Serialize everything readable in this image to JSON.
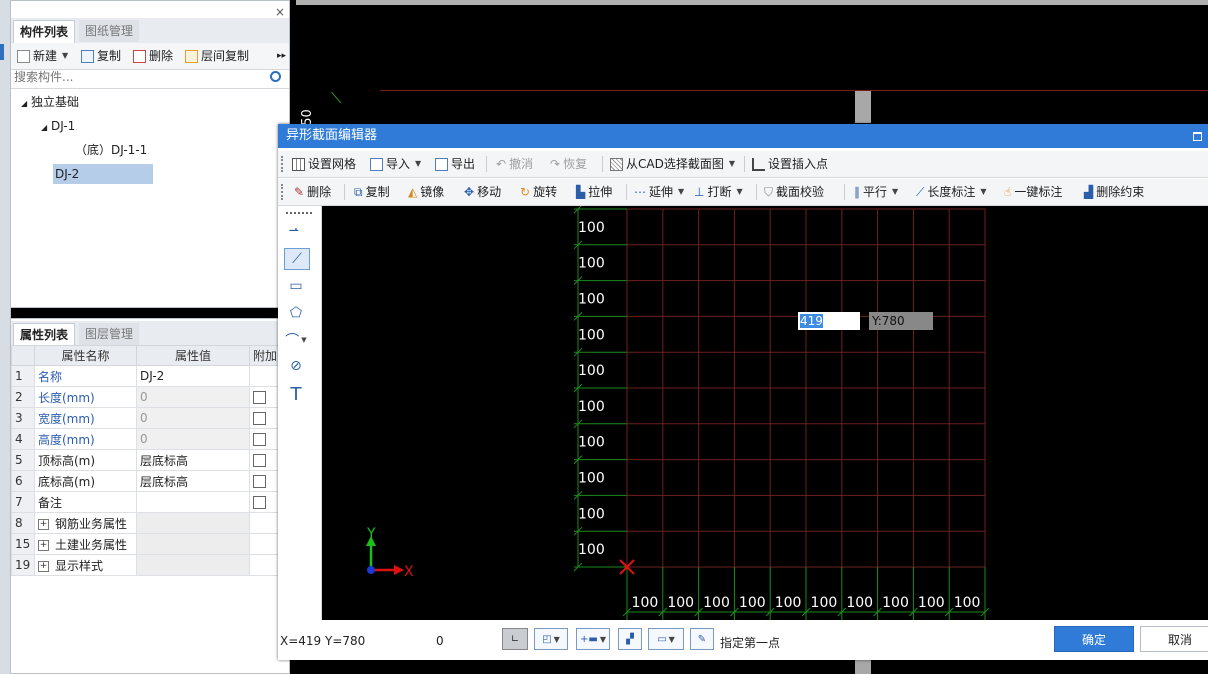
{
  "component_panel": {
    "tabs": [
      "构件列表",
      "图纸管理"
    ],
    "close": "×",
    "toolbar": {
      "new": "新建",
      "copy": "复制",
      "delete": "删除",
      "floor_copy": "层间复制",
      "more": "▸▸"
    },
    "search_placeholder": "搜索构件...",
    "tree": {
      "root": "独立基础",
      "n1": "DJ-1",
      "n1_child": "（底）DJ-1-1",
      "n2": "DJ-2"
    }
  },
  "property_panel": {
    "tabs": [
      "属性列表",
      "图层管理"
    ],
    "headers": [
      "属性名称",
      "属性值",
      "附加"
    ],
    "rows": [
      {
        "n": "1",
        "name": "名称",
        "value": "DJ-2"
      },
      {
        "n": "2",
        "name": "长度(mm)",
        "value": "0"
      },
      {
        "n": "3",
        "name": "宽度(mm)",
        "value": "0"
      },
      {
        "n": "4",
        "name": "高度(mm)",
        "value": "0"
      },
      {
        "n": "5",
        "name": "顶标高(m)",
        "value": "层底标高"
      },
      {
        "n": "6",
        "name": "底标高(m)",
        "value": "层底标高"
      },
      {
        "n": "7",
        "name": "备注",
        "value": ""
      },
      {
        "n": "8",
        "name": "钢筋业务属性",
        "value": ""
      },
      {
        "n": "15",
        "name": "土建业务属性",
        "value": ""
      },
      {
        "n": "19",
        "name": "显示样式",
        "value": ""
      }
    ]
  },
  "background": {
    "side_label": "50"
  },
  "dialog": {
    "title": "异形截面编辑器",
    "toolbar1": {
      "set_grid": "设置网格",
      "import": "导入",
      "export": "导出",
      "undo": "撤消",
      "redo": "恢复",
      "from_cad": "从CAD选择截面图",
      "insert_point": "设置插入点"
    },
    "toolbar2": {
      "delete": "删除",
      "copy": "复制",
      "mirror": "镜像",
      "move": "移动",
      "rotate": "旋转",
      "stretch": "拉伸",
      "extend": "延伸",
      "break": "打断",
      "check": "截面校验",
      "parallel": "平行",
      "length_dim": "长度标注",
      "one_key_dim": "一键标注",
      "delete_constraint": "删除约束"
    },
    "canvas": {
      "grid_label": "100",
      "rows": 10,
      "cols": 10,
      "x_input": "419",
      "y_readout": "Y:780",
      "axis_x": "X",
      "axis_y": "Y"
    },
    "status": {
      "coords": "X=419 Y=780",
      "value": "0",
      "hint": "指定第一点",
      "ok": "确定",
      "cancel": "取消"
    }
  }
}
